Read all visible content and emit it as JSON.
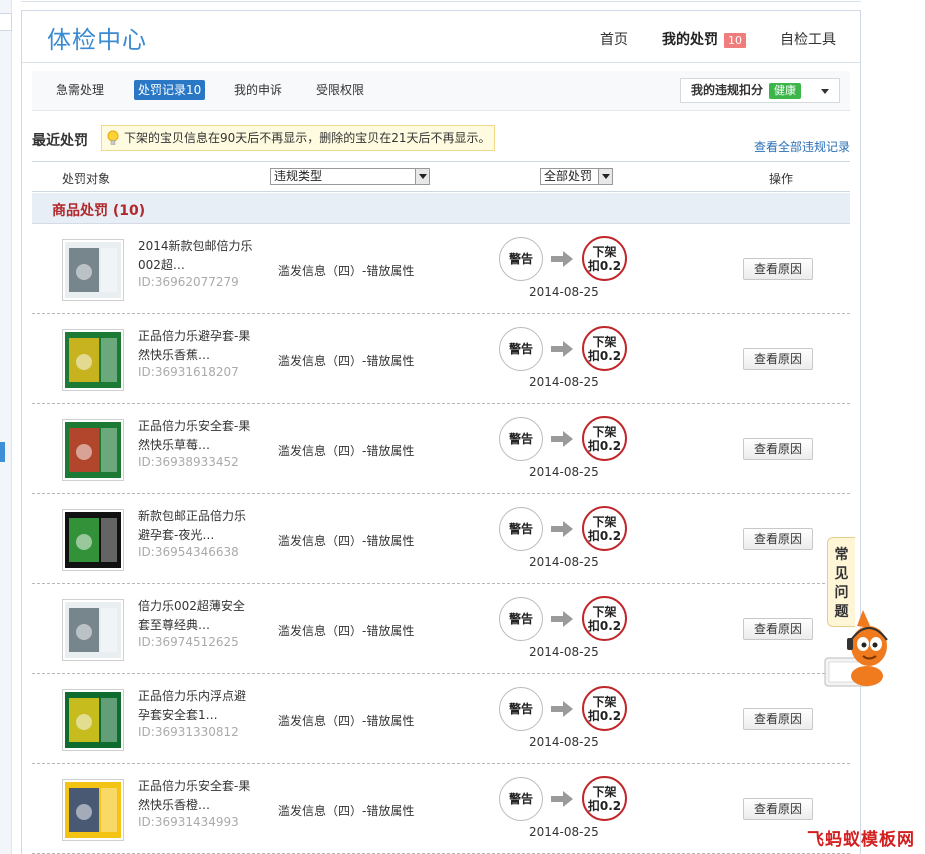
{
  "header": {
    "site_title": "体检中心",
    "nav": [
      {
        "label": "首页"
      },
      {
        "label": "我的处罚",
        "badge": "10"
      },
      {
        "label": "自检工具"
      }
    ]
  },
  "subnav": {
    "tabs": [
      {
        "label": "急需处理"
      },
      {
        "label": "处罚记录10",
        "active": true
      },
      {
        "label": "我的申诉"
      },
      {
        "label": "受限权限"
      }
    ],
    "score_label": "我的违规扣分",
    "score_badge": "健康"
  },
  "recent": {
    "title": "最近处罚",
    "tip": "下架的宝贝信息在90天后不再显示，删除的宝贝在21天后不再显示。",
    "view_all": "查看全部违规记录"
  },
  "filters": {
    "target_label": "处罚对象",
    "type_select": "违规类型",
    "punish_select": "全部处罚",
    "action_label": "操作"
  },
  "section": {
    "title": "商品处罚 (10)"
  },
  "rows": [
    {
      "name": "2014新款包邮倍力乐002超…",
      "id": "ID:36962077279",
      "violation": "滥发信息（四）-错放属性",
      "warn": "警告",
      "penalty_1": "下架",
      "penalty_2": "扣0.2",
      "date": "2014-08-25",
      "button": "查看原因"
    },
    {
      "name": "正品倍力乐避孕套-果然快乐香蕉…",
      "id": "ID:36931618207",
      "violation": "滥发信息（四）-错放属性",
      "warn": "警告",
      "penalty_1": "下架",
      "penalty_2": "扣0.2",
      "date": "2014-08-25",
      "button": "查看原因"
    },
    {
      "name": "正品倍力乐安全套-果然快乐草莓…",
      "id": "ID:36938933452",
      "violation": "滥发信息（四）-错放属性",
      "warn": "警告",
      "penalty_1": "下架",
      "penalty_2": "扣0.2",
      "date": "2014-08-25",
      "button": "查看原因"
    },
    {
      "name": "新款包邮正品倍力乐避孕套-夜光…",
      "id": "ID:36954346638",
      "violation": "滥发信息（四）-错放属性",
      "warn": "警告",
      "penalty_1": "下架",
      "penalty_2": "扣0.2",
      "date": "2014-08-25",
      "button": "查看原因"
    },
    {
      "name": "倍力乐002超薄安全套至尊经典…",
      "id": "ID:36974512625",
      "violation": "滥发信息（四）-错放属性",
      "warn": "警告",
      "penalty_1": "下架",
      "penalty_2": "扣0.2",
      "date": "2014-08-25",
      "button": "查看原因"
    },
    {
      "name": "正品倍力乐内浮点避孕套安全套1…",
      "id": "ID:36931330812",
      "violation": "滥发信息（四）-错放属性",
      "warn": "警告",
      "penalty_1": "下架",
      "penalty_2": "扣0.2",
      "date": "2014-08-25",
      "button": "查看原因"
    },
    {
      "name": "正品倍力乐安全套-果然快乐香橙…",
      "id": "ID:36931434993",
      "violation": "滥发信息（四）-错放属性",
      "warn": "警告",
      "penalty_1": "下架",
      "penalty_2": "扣0.2",
      "date": "2014-08-25",
      "button": "查看原因"
    }
  ],
  "faq": {
    "label": "常见问题"
  },
  "watermark": "飞蚂蚁模板网",
  "colors": {
    "title_blue": "#3a8bd2",
    "active_tab": "#2a78c5",
    "badge_red": "#f07c7c",
    "badge_green": "#3cb54a",
    "penalty_red": "#c0262a",
    "section_red": "#b0282b",
    "link_blue": "#2a6fb5"
  },
  "icons": {
    "tip": "lightbulb-icon",
    "flow": "arrow-right-icon",
    "dropdown": "caret-down-icon",
    "mascot": "mascot-icon"
  }
}
